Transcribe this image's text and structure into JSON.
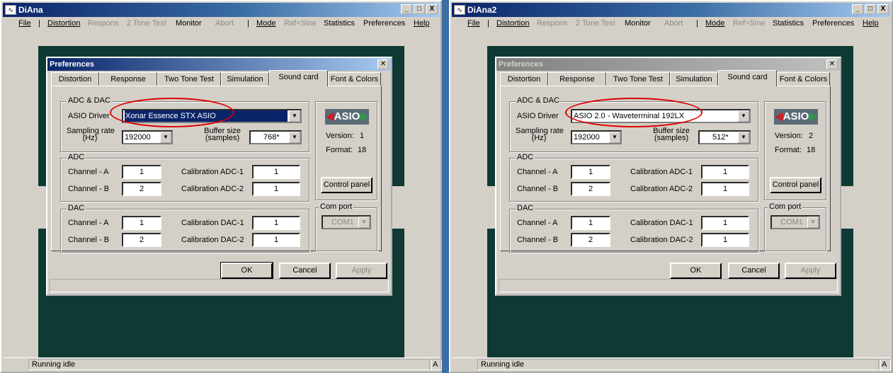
{
  "menu_labels": {
    "file": "File",
    "distortion": "Distortion",
    "responses": "Respons",
    "two_tone": "2 Tone Test",
    "monitor": "Monitor",
    "abort": "Abort",
    "mode": "Mode",
    "ref": "Ref=Sine",
    "statistics": "Statistics",
    "preferences": "Preferences",
    "help": "Help",
    "sep": "|"
  },
  "window_buttons": {
    "minimize": "_",
    "maximize": "□",
    "close": "X"
  },
  "windows": [
    {
      "title": "DiAna",
      "status": {
        "text": "Running idle",
        "indicator": "A"
      },
      "dialog": {
        "title": "Preferences",
        "active": true,
        "tabs": [
          "Distortion",
          "Response",
          "Two Tone Test",
          "Simulation",
          "Sound card",
          "Font & Colors"
        ],
        "selected_tab": "Sound card",
        "adc_dac": {
          "group_label": "ADC & DAC",
          "driver_label": "ASIO Driver",
          "driver_value": "Xonar Essence STX ASIO",
          "sampling_label_1": "Sampling rate",
          "sampling_label_2": "(Hz)",
          "sampling_value": "192000",
          "buffer_label_1": "Buffer size",
          "buffer_label_2": "(samples)",
          "buffer_value": "768*"
        },
        "asio": {
          "logo": "ASIO",
          "version_label": "Version:",
          "version_value": "1",
          "format_label": "Format:",
          "format_value": "18",
          "control_panel": "Control panel"
        },
        "adc": {
          "group_label": "ADC",
          "ch_a_label": "Channel - A",
          "ch_a_value": "1",
          "ch_b_label": "Channel - B",
          "ch_b_value": "2",
          "cal1_label": "Calibration ADC-1",
          "cal1_value": "1",
          "cal2_label": "Calibration ADC-2",
          "cal2_value": "1"
        },
        "dac": {
          "group_label": "DAC",
          "ch_a_label": "Channel - A",
          "ch_a_value": "1",
          "ch_b_label": "Channel - B",
          "ch_b_value": "2",
          "cal1_label": "Calibration DAC-1",
          "cal1_value": "1",
          "cal2_label": "Calibration DAC-2",
          "cal2_value": "1"
        },
        "com": {
          "group_label": "Com port",
          "value": "COM1"
        },
        "buttons": {
          "ok": "OK",
          "cancel": "Cancel",
          "apply": "Apply"
        }
      }
    },
    {
      "title": "DiAna2",
      "status": {
        "text": "Running idle",
        "indicator": "A"
      },
      "dialog": {
        "title": "Preferences",
        "active": false,
        "tabs": [
          "Distortion",
          "Response",
          "Two Tone Test",
          "Simulation",
          "Sound card",
          "Font & Colors"
        ],
        "selected_tab": "Sound card",
        "adc_dac": {
          "group_label": "ADC & DAC",
          "driver_label": "ASIO Driver",
          "driver_value": "ASIO 2.0 - Waveterminal 192LX",
          "sampling_label_1": "Sampling rate",
          "sampling_label_2": "(Hz)",
          "sampling_value": "192000",
          "buffer_label_1": "Buffer size",
          "buffer_label_2": "(samples)",
          "buffer_value": "512*"
        },
        "asio": {
          "logo": "ASIO",
          "version_label": "Version:",
          "version_value": "2",
          "format_label": "Format:",
          "format_value": "18",
          "control_panel": "Control panel"
        },
        "adc": {
          "group_label": "ADC",
          "ch_a_label": "Channel - A",
          "ch_a_value": "1",
          "ch_b_label": "Channel - B",
          "ch_b_value": "2",
          "cal1_label": "Calibration ADC-1",
          "cal1_value": "1",
          "cal2_label": "Calibration ADC-2",
          "cal2_value": "1"
        },
        "dac": {
          "group_label": "DAC",
          "ch_a_label": "Channel - A",
          "ch_a_value": "1",
          "ch_b_label": "Channel - B",
          "ch_b_value": "2",
          "cal1_label": "Calibration DAC-1",
          "cal1_value": "1",
          "cal2_label": "Calibration DAC-2",
          "cal2_value": "1"
        },
        "com": {
          "group_label": "Com port",
          "value": "COM1"
        },
        "buttons": {
          "ok": "OK",
          "cancel": "Cancel",
          "apply": "Apply"
        }
      }
    }
  ],
  "colors": {
    "title_active": "#0a246a",
    "face": "#d4d0c8",
    "dark_panel": "#0f3a33",
    "ring": "#e00000"
  }
}
